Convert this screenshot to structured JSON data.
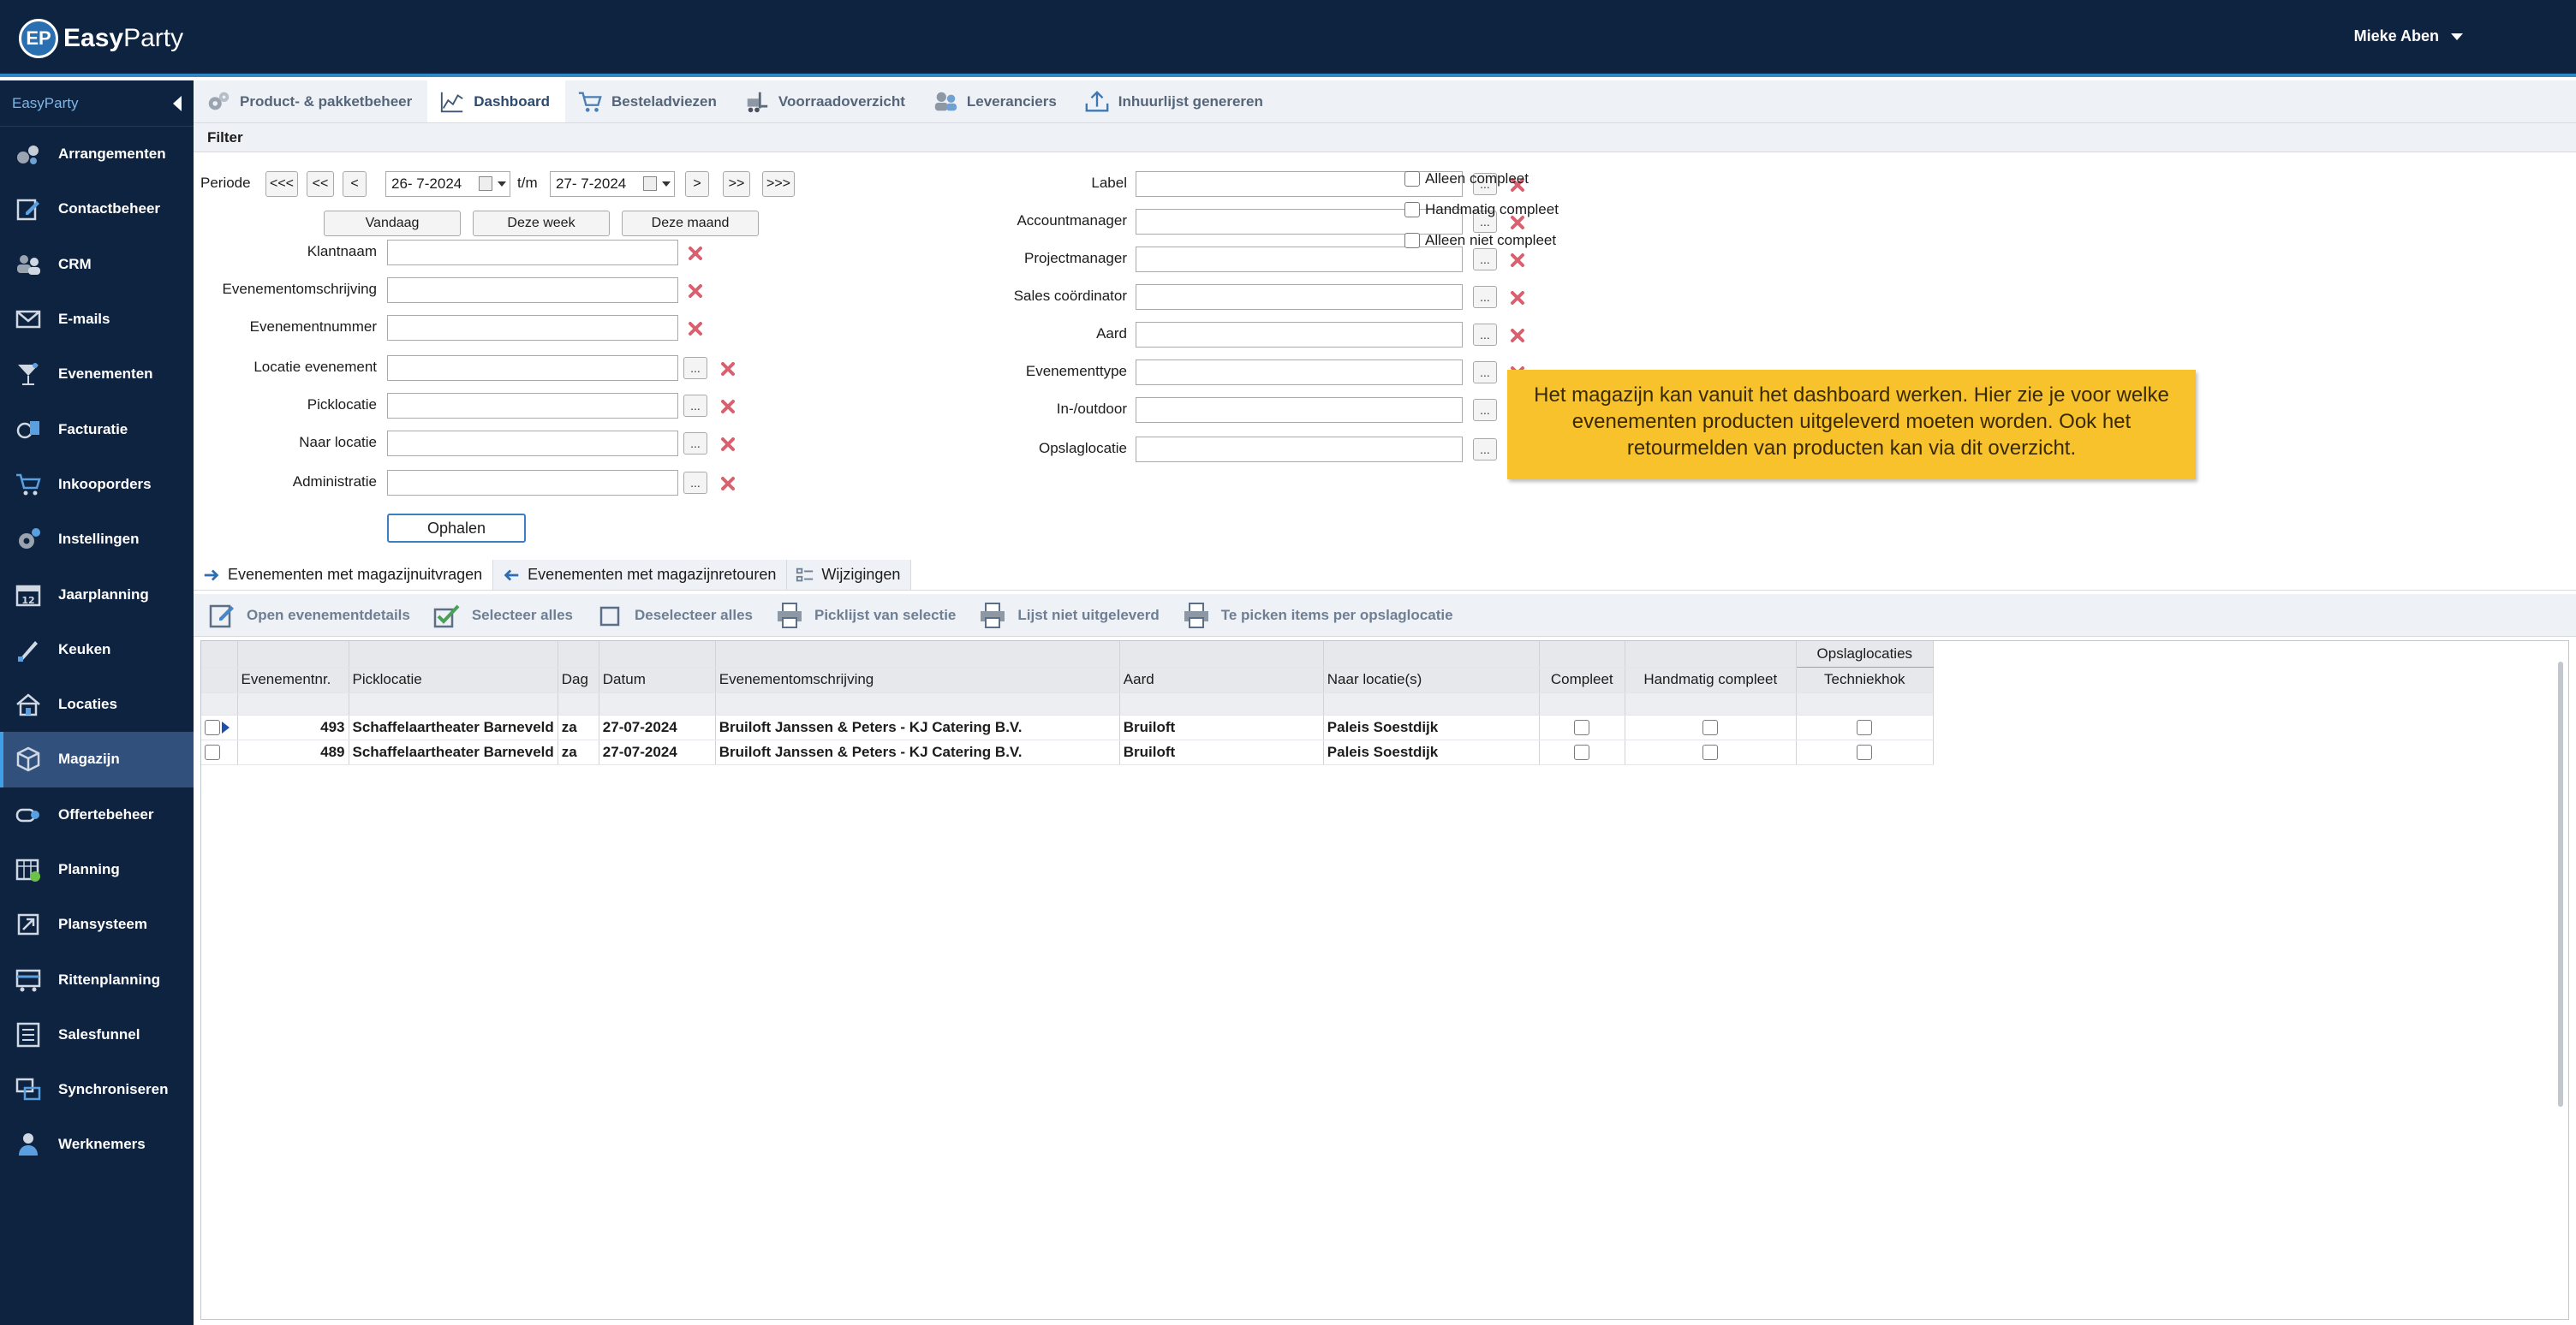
{
  "app": {
    "logo_badge": "EP",
    "logo_bold": "Easy",
    "logo_rest": "Party",
    "user_name": "Mieke Aben"
  },
  "sidebar": {
    "header": "EasyParty",
    "items": [
      {
        "label": "Arrangementen",
        "icon": "arrangement-icon"
      },
      {
        "label": "Contactbeheer",
        "icon": "contact-edit-icon"
      },
      {
        "label": "CRM",
        "icon": "crm-users-icon"
      },
      {
        "label": "E-mails",
        "icon": "mail-icon"
      },
      {
        "label": "Evenementen",
        "icon": "cocktail-icon"
      },
      {
        "label": "Facturatie",
        "icon": "invoice-icon"
      },
      {
        "label": "Inkooporders",
        "icon": "cart-icon"
      },
      {
        "label": "Instellingen",
        "icon": "gear-icon"
      },
      {
        "label": "Jaarplanning",
        "icon": "calendar-icon"
      },
      {
        "label": "Keuken",
        "icon": "knife-icon"
      },
      {
        "label": "Locaties",
        "icon": "house-icon"
      },
      {
        "label": "Magazijn",
        "icon": "box-icon"
      },
      {
        "label": "Offertebeheer",
        "icon": "offer-icon"
      },
      {
        "label": "Planning",
        "icon": "planning-calendar-icon"
      },
      {
        "label": "Plansysteem",
        "icon": "plan-system-icon"
      },
      {
        "label": "Rittenplanning",
        "icon": "truck-icon"
      },
      {
        "label": "Salesfunnel",
        "icon": "salesfunnel-icon"
      },
      {
        "label": "Synchroniseren",
        "icon": "sync-icon"
      },
      {
        "label": "Werknemers",
        "icon": "employee-icon"
      }
    ]
  },
  "tabs": [
    {
      "label": "Product- & pakketbeheer"
    },
    {
      "label": "Dashboard"
    },
    {
      "label": "Besteladviezen"
    },
    {
      "label": "Voorraadoverzicht"
    },
    {
      "label": "Leveranciers"
    },
    {
      "label": "Inhuurlijst genereren"
    }
  ],
  "filter": {
    "title": "Filter",
    "periode_label": "Periode",
    "nav": {
      "first": "<<<",
      "prev2": "<<",
      "prev": "<",
      "next": ">",
      "next2": ">>",
      "last": ">>>"
    },
    "date_from": "26- 7-2024",
    "tm_label": "t/m",
    "date_to": "27- 7-2024",
    "quick": {
      "today": "Vandaag",
      "week": "Deze week",
      "month": "Deze maand"
    },
    "left_fields": [
      {
        "label": "Klantnaam",
        "value": ""
      },
      {
        "label": "Evenementomschrijving",
        "value": ""
      },
      {
        "label": "Evenementnummer",
        "value": ""
      },
      {
        "label": "Locatie evenement",
        "value": ""
      },
      {
        "label": "Picklocatie",
        "value": ""
      },
      {
        "label": "Naar locatie",
        "value": ""
      },
      {
        "label": "Administratie",
        "value": ""
      }
    ],
    "right_fields": [
      {
        "label": "Label",
        "value": ""
      },
      {
        "label": "Accountmanager",
        "value": ""
      },
      {
        "label": "Projectmanager",
        "value": ""
      },
      {
        "label": "Sales coördinator",
        "value": ""
      },
      {
        "label": "Aard",
        "value": ""
      },
      {
        "label": "Evenementtype",
        "value": ""
      },
      {
        "label": "In-/outdoor",
        "value": ""
      },
      {
        "label": "Opslaglocatie",
        "value": ""
      }
    ],
    "dots": "...",
    "checkboxes": [
      {
        "label": "Alleen compleet",
        "checked": false
      },
      {
        "label": "Handmatig compleet",
        "checked": false
      },
      {
        "label": "Alleen niet compleet",
        "checked": false
      }
    ],
    "fetch_button": "Ophalen"
  },
  "note": "Het magazijn kan vanuit het dashboard werken. Hier zie je voor welke evenementen producten uitgeleverd moeten worden. Ook het retourmelden van producten kan via dit overzicht.",
  "subtabs": [
    {
      "label": "Evenementen met magazijnuitvragen"
    },
    {
      "label": "Evenementen met magazijnretouren"
    },
    {
      "label": "Wijzigingen"
    }
  ],
  "toolbar": [
    {
      "label": "Open evenementdetails"
    },
    {
      "label": "Selecteer alles"
    },
    {
      "label": "Deselecteer alles"
    },
    {
      "label": "Picklijst van selectie"
    },
    {
      "label": "Lijst niet uitgeleverd"
    },
    {
      "label": "Te picken items per opslaglocatie"
    }
  ],
  "grid": {
    "group_header": "Opslaglocaties",
    "columns": [
      "Evenementnr.",
      "Picklocatie",
      "Dag",
      "Datum",
      "Evenementomschrijving",
      "Aard",
      "Naar locatie(s)",
      "Compleet",
      "Handmatig compleet",
      "Techniekhok"
    ],
    "rows": [
      {
        "nr": "493",
        "picklocatie": "Schaffelaartheater Barneveld",
        "dag": "za",
        "datum": "27-07-2024",
        "omschrijving": "Bruiloft Janssen & Peters - KJ Catering B.V.",
        "aard": "Bruiloft",
        "naar": "Paleis Soestdijk"
      },
      {
        "nr": "489",
        "picklocatie": "Schaffelaartheater Barneveld",
        "dag": "za",
        "datum": "27-07-2024",
        "omschrijving": "Bruiloft Janssen & Peters - KJ Catering B.V.",
        "aard": "Bruiloft",
        "naar": "Paleis Soestdijk"
      }
    ]
  }
}
